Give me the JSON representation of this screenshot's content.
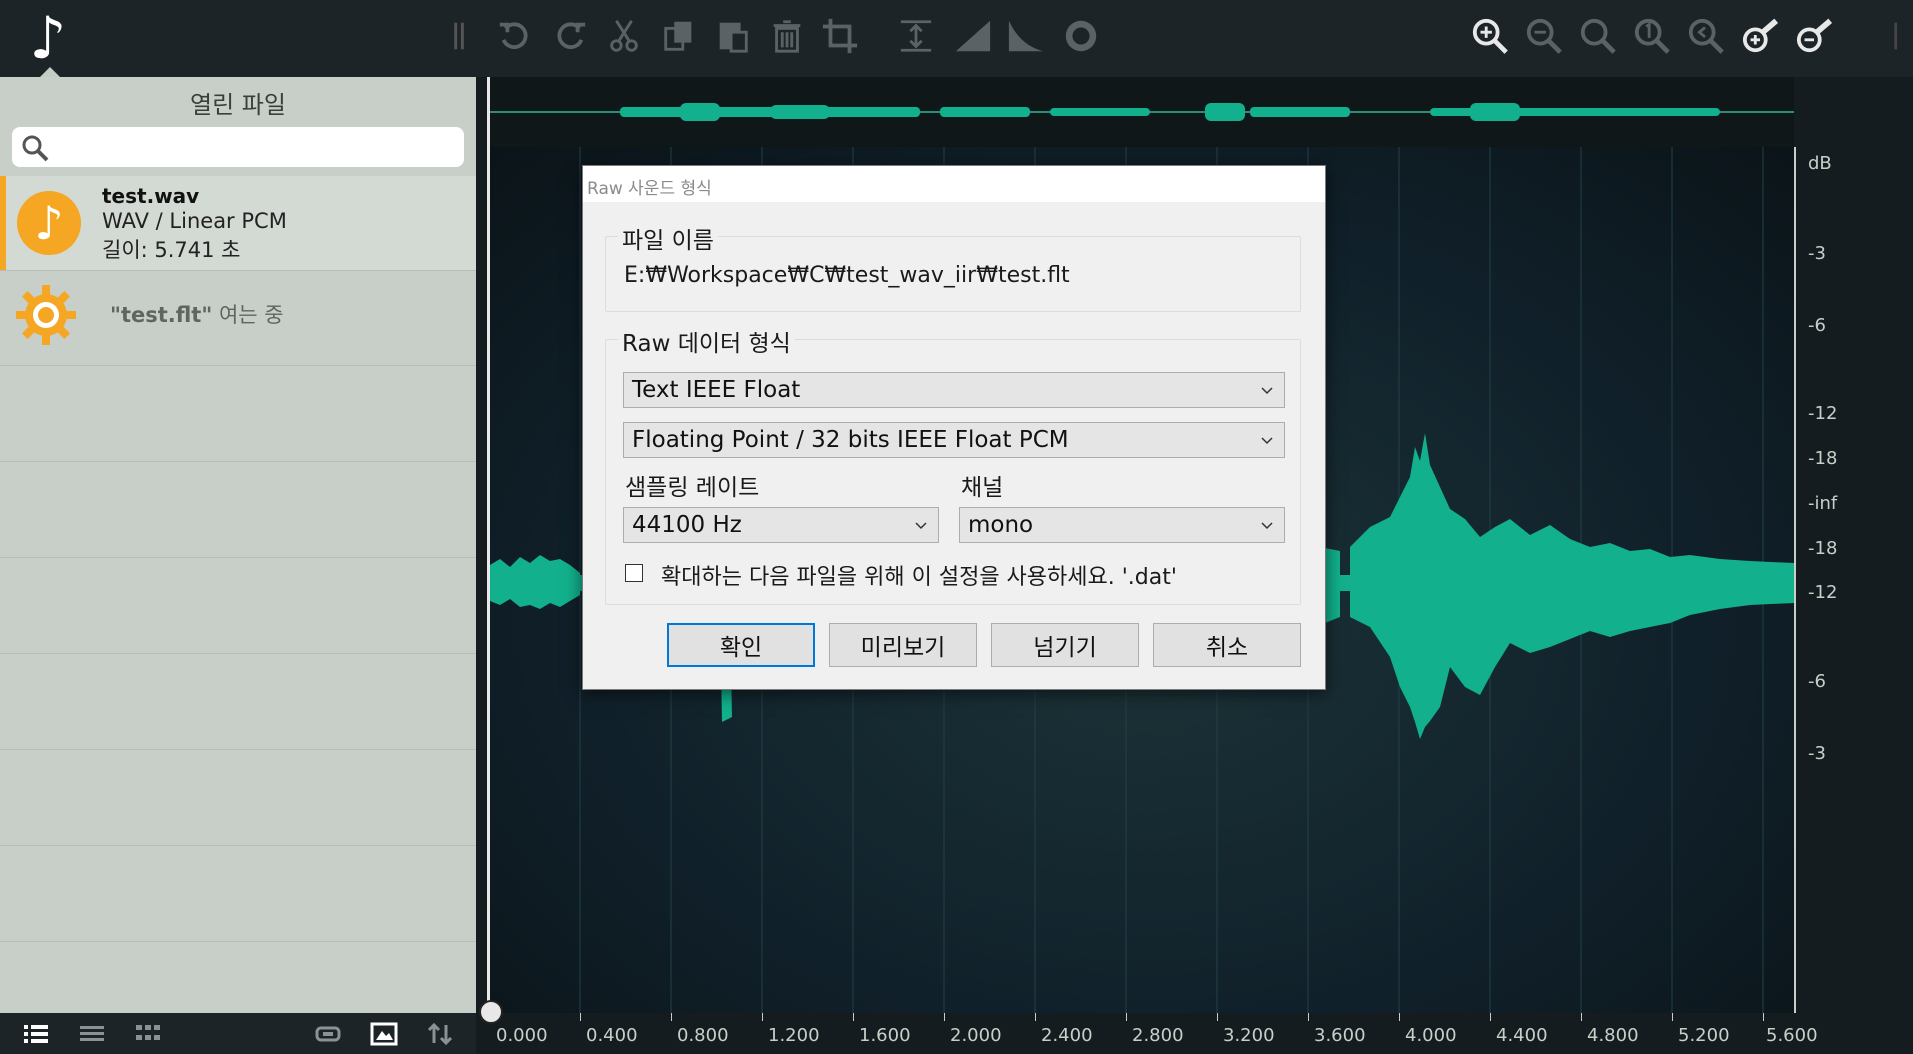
{
  "toolbar": {
    "icons": [
      "divider-icon",
      "undo-icon",
      "redo-icon",
      "cut-icon",
      "copy-icon",
      "paste-icon",
      "delete-icon",
      "crop-icon",
      "fit-height-icon",
      "fade-in-icon",
      "fade-out-icon",
      "normalize-icon",
      "zoom-in-icon",
      "zoom-out-icon",
      "zoom-fit-icon",
      "zoom-one-icon",
      "zoom-selection-icon",
      "vertical-zoom-in-icon",
      "vertical-zoom-out-icon"
    ]
  },
  "sidebar": {
    "title": "열린 파일",
    "search_placeholder": "",
    "files": [
      {
        "name": "test.wav",
        "format": "WAV / Linear PCM",
        "length": "길이: 5.741 초"
      }
    ],
    "opening": {
      "file": "\"test.flt\"",
      "status": "여는 중"
    }
  },
  "waveform": {
    "db_labels": [
      "dB",
      "-3",
      "-6",
      "-12",
      "-18",
      "-inf",
      "-18",
      "-12",
      "-6",
      "-3"
    ],
    "time_labels": [
      "0.000",
      "0.400",
      "0.800",
      "1.200",
      "1.600",
      "2.000",
      "2.400",
      "2.800",
      "3.200",
      "3.600",
      "4.000",
      "4.400",
      "4.800",
      "5.200",
      "5.600"
    ],
    "wave_color": "#12b08c"
  },
  "dialog": {
    "title": "Raw 사운드 형식",
    "file_group_label": "파일 이름",
    "file_path": "E:₩Workspace₩C₩test_wav_iir₩test.flt",
    "format_group_label": "Raw 데이터 형식",
    "data_format": "Text IEEE Float",
    "sample_format": "Floating Point / 32 bits IEEE Float PCM",
    "sample_rate_label": "샘플링 레이트",
    "sample_rate": "44100 Hz",
    "channel_label": "채널",
    "channel": "mono",
    "remember_label": "확대하는 다음 파일을 위해 이 설정을 사용하세요. '.dat'",
    "remember_checked": false,
    "buttons": {
      "ok": "확인",
      "preview": "미리보기",
      "skip": "넘기기",
      "cancel": "취소"
    }
  }
}
